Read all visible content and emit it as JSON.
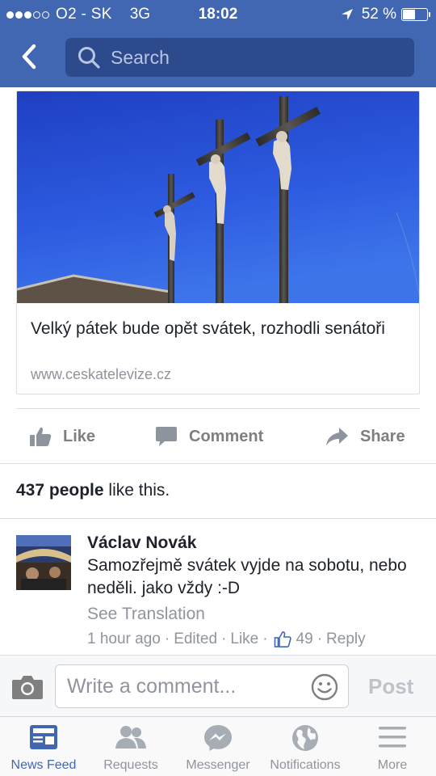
{
  "status_bar": {
    "carrier": "O2 - SK",
    "network": "3G",
    "time": "18:02",
    "battery_percent": "52 %",
    "battery_level": 0.52,
    "signal_bars_filled": 3,
    "signal_bars_total": 5
  },
  "header": {
    "search_placeholder": "Search",
    "back_icon": "chevron-left-icon",
    "search_icon": "magnifier-icon"
  },
  "post": {
    "link": {
      "title": "Velký pátek bude opět svátek, rozhodli senátoři",
      "domain": "www.ceskatelevize.cz"
    },
    "actions": {
      "like": "Like",
      "comment": "Comment",
      "share": "Share"
    },
    "likes": {
      "count_text": "437 people",
      "suffix": " like this."
    }
  },
  "comment": {
    "author": "Václav Novák",
    "text": "Samozřejmě svátek vyjde na sobotu, nebo neděli. jako vždy :-D",
    "see_translation": "See Translation",
    "meta": {
      "time": "1 hour ago",
      "edited": "Edited",
      "like": "Like",
      "like_count": "49",
      "reply": "Reply"
    }
  },
  "composer": {
    "placeholder": "Write a comment...",
    "post_label": "Post"
  },
  "tabbar": {
    "items": [
      {
        "label": "News Feed",
        "icon": "news-feed-icon",
        "active": true
      },
      {
        "label": "Requests",
        "icon": "friends-icon",
        "active": false
      },
      {
        "label": "Messenger",
        "icon": "messenger-icon",
        "active": false
      },
      {
        "label": "Notifications",
        "icon": "globe-icon",
        "active": false
      },
      {
        "label": "More",
        "icon": "hamburger-icon",
        "active": false
      }
    ]
  },
  "colors": {
    "brand_blue": "#4267b2",
    "search_bg": "#2c4a8c",
    "muted_text": "#90949c",
    "action_gray": "#7f7f7f"
  }
}
